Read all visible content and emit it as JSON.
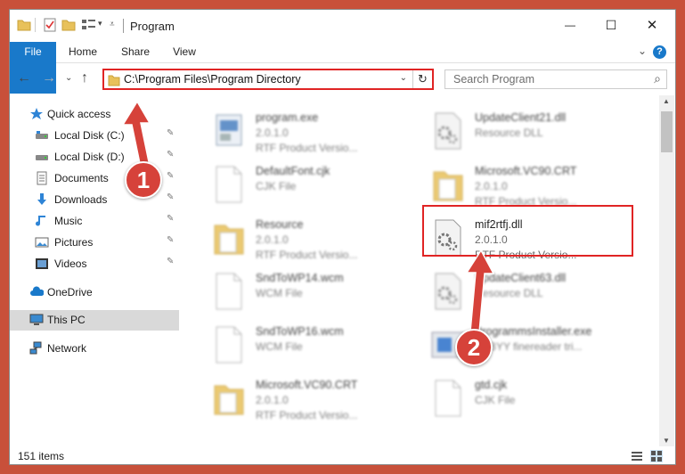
{
  "window": {
    "title": "Program",
    "quick_access_dropdown": "▾",
    "minimize": "—",
    "maximize": "☐",
    "close": "✕"
  },
  "ribbon": {
    "tabs": [
      "File",
      "Home",
      "Share",
      "View"
    ],
    "expand": "⌄",
    "help": "?"
  },
  "address": {
    "path": "C:\\Program Files\\Program Directory",
    "dropdown": "⌄",
    "refresh": "↻"
  },
  "search": {
    "placeholder": "Search Program"
  },
  "nav": {
    "back": "←",
    "forward": "→",
    "recent": "⌄",
    "up": "↑"
  },
  "sidebar": {
    "items": [
      {
        "label": "Quick access",
        "icon": "star-icon",
        "pinned": false
      },
      {
        "label": "Local Disk (C:)",
        "icon": "drive-icon",
        "pinned": true
      },
      {
        "label": "Local Disk (D:)",
        "icon": "drive-icon",
        "pinned": true
      },
      {
        "label": "Documents",
        "icon": "documents-icon",
        "pinned": true
      },
      {
        "label": "Downloads",
        "icon": "download-icon",
        "pinned": true
      },
      {
        "label": "Music",
        "icon": "music-icon",
        "pinned": true
      },
      {
        "label": "Pictures",
        "icon": "pictures-icon",
        "pinned": true
      },
      {
        "label": "Videos",
        "icon": "videos-icon",
        "pinned": true
      },
      {
        "label": "OneDrive",
        "icon": "cloud-icon",
        "pinned": false
      },
      {
        "label": "This PC",
        "icon": "computer-icon",
        "pinned": false,
        "selected": true
      },
      {
        "label": "Network",
        "icon": "network-icon",
        "pinned": false
      }
    ],
    "pin_glyph": "📌"
  },
  "files": [
    {
      "name": "program.exe",
      "line1": "2.0.1.0",
      "line2": "RTF  Product Versio...",
      "icon": "exe-icon",
      "blurred": true
    },
    {
      "name": "UpdateClient21.dll",
      "line1": "Resource DLL",
      "line2": "",
      "icon": "dll-icon",
      "blurred": true
    },
    {
      "name": "DefaultFont.cjk",
      "line1": "CJK File",
      "line2": "",
      "icon": "blank-file-icon",
      "blurred": true
    },
    {
      "name": "Microsoft.VC90.CRT",
      "line1": "2.0.1.0",
      "line2": "RTF  Product Versio...",
      "icon": "folder-file-icon",
      "blurred": true
    },
    {
      "name": "Resource",
      "line1": "2.0.1.0",
      "line2": "RTF  Product Versio...",
      "icon": "folder-file-icon",
      "blurred": true
    },
    {
      "name": "mif2rtfj.dll",
      "line1": "2.0.1.0",
      "line2": "RTF  Product Versio...",
      "icon": "dll-icon",
      "blurred": false
    },
    {
      "name": "SndToWP14.wcm",
      "line1": "WCM File",
      "line2": "",
      "icon": "blank-file-icon",
      "blurred": true
    },
    {
      "name": "UpdateClient63.dll",
      "line1": "Resource DLL",
      "line2": "",
      "icon": "dll-icon",
      "blurred": true
    },
    {
      "name": "SndToWP16.wcm",
      "line1": "WCM File",
      "line2": "",
      "icon": "blank-file-icon",
      "blurred": true
    },
    {
      "name": "ProgrammsInstaller.exe",
      "line1": "ABBYY finereader tri...",
      "line2": "",
      "icon": "installer-icon",
      "blurred": true
    },
    {
      "name": "Microsoft.VC90.CRT",
      "line1": "2.0.1.0",
      "line2": "RTF  Product Versio...",
      "icon": "folder-file-icon",
      "blurred": true
    },
    {
      "name": "gtd.cjk",
      "line1": "CJK File",
      "line2": "",
      "icon": "blank-file-icon",
      "blurred": true
    }
  ],
  "status": {
    "count": "151 items"
  },
  "annotations": {
    "step1": "1",
    "step2": "2",
    "color": "#e02424",
    "badge_color": "#d6423a"
  },
  "colors": {
    "accent": "#1979ca",
    "selected_nav": "#d9d9d9",
    "folder": "#e8c15a"
  }
}
